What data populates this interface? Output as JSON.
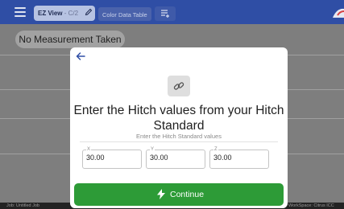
{
  "toolbar": {
    "active_tab_label": "EZ View",
    "active_tab_sub": " - C/2",
    "tab_color_table": "Color Data Table"
  },
  "background": {
    "status_pill": "No Measurement Taken",
    "footer_left": "Job: Untitled Job",
    "footer_right": "WorkSpace: Citrus ICC"
  },
  "dialog": {
    "title": "Enter the Hitch values from your Hitch Standard",
    "subtitle": "Enter the Hitch Standard values",
    "fields": [
      {
        "label": "X",
        "value": "30.00"
      },
      {
        "label": "Y",
        "value": "30.00"
      },
      {
        "label": "Z",
        "value": "30.00"
      }
    ],
    "continue_label": "Continue"
  },
  "colors": {
    "topbar": "#2f4ea5",
    "overlay": "#7e7e7e",
    "continue": "#2d9b37"
  },
  "icons": [
    "menu-icon",
    "pencil-icon",
    "add-tab-icon",
    "back-arrow-icon",
    "link-icon",
    "bolt-icon"
  ]
}
